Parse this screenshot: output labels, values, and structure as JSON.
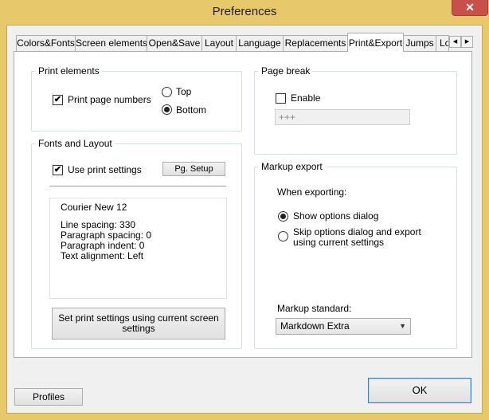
{
  "window": {
    "title": "Preferences",
    "close_glyph": "✕"
  },
  "tabs": [
    {
      "label": "Colors&Fonts"
    },
    {
      "label": "Screen elements"
    },
    {
      "label": "Open&Save"
    },
    {
      "label": "Layout"
    },
    {
      "label": "Language"
    },
    {
      "label": "Replacements"
    },
    {
      "label": "Print&Export",
      "active": true
    },
    {
      "label": "Jumps"
    },
    {
      "label": "Lo"
    }
  ],
  "tab_scroll": {
    "left_glyph": "◀",
    "right_glyph": "▶"
  },
  "print_elements": {
    "legend": "Print elements",
    "print_page_numbers": {
      "label": "Print page numbers",
      "checked": true,
      "mark": "✔"
    },
    "top": {
      "label": "Top",
      "selected": false
    },
    "bottom": {
      "label": "Bottom",
      "selected": true
    }
  },
  "page_break": {
    "legend": "Page break",
    "enable": {
      "label": "Enable",
      "checked": false
    },
    "value": "+++"
  },
  "fonts_layout": {
    "legend": "Fonts and Layout",
    "use_print_settings": {
      "label": "Use print settings",
      "checked": true,
      "mark": "✔"
    },
    "pg_setup_label": "Pg. Setup",
    "preview": {
      "font": "Courier New 12",
      "line_spacing": "Line spacing: 330",
      "paragraph_spacing": "Paragraph spacing: 0",
      "paragraph_indent": "Paragraph indent: 0",
      "text_alignment": "Text alignment: Left"
    },
    "set_print_settings_label_1": "Set print settings using current screen",
    "set_print_settings_label_2": "settings"
  },
  "markup_export": {
    "legend": "Markup export",
    "when_exporting": "When exporting:",
    "show_options": {
      "label": "Show options dialog",
      "selected": true
    },
    "skip_options": {
      "label_1": "Skip options dialog and export",
      "label_2": "using current settings",
      "selected": false
    },
    "standard_label": "Markup standard:",
    "standard_value": "Markdown Extra",
    "dropdown_glyph": "▼"
  },
  "footer": {
    "profiles_label": "Profiles",
    "ok_label": "OK"
  }
}
